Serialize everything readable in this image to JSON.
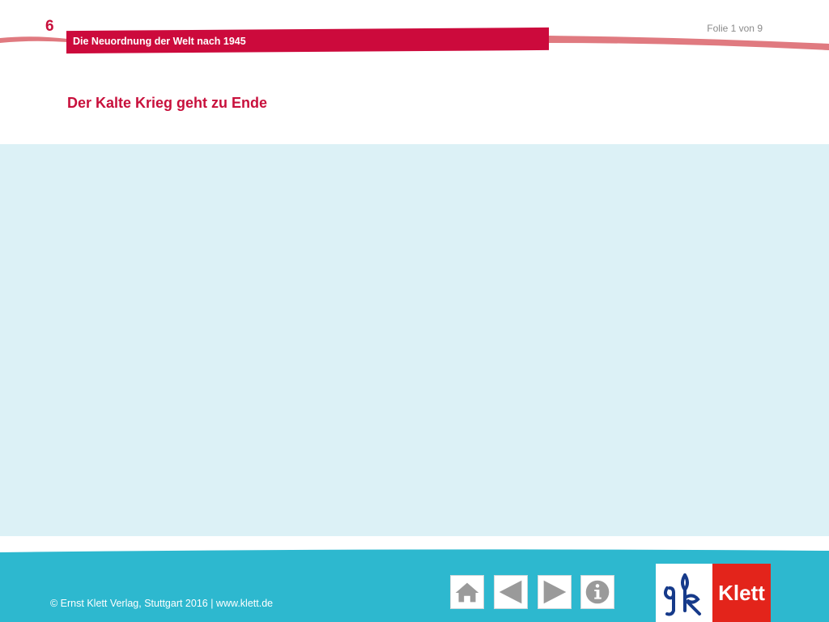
{
  "header": {
    "chapter_number": "6",
    "chapter_title": "Die Neuordnung der Welt nach 1945",
    "slide_counter": "Folie 1 von 9"
  },
  "slide": {
    "title": "Der Kalte Krieg geht zu Ende"
  },
  "footer": {
    "copyright": "© Ernst Klett Verlag, Stuttgart 2016 | www.klett.de",
    "nav": [
      {
        "name": "home",
        "icon": "home-icon"
      },
      {
        "name": "previous",
        "icon": "arrow-left-icon"
      },
      {
        "name": "next",
        "icon": "arrow-right-icon"
      },
      {
        "name": "info",
        "icon": "info-icon"
      }
    ],
    "logo_text": "Klett"
  },
  "colors": {
    "accent_red": "#cc0a3c",
    "content_background": "#dcf1f6",
    "footer_teal": "#2db8cf",
    "icon_gray": "#9a9a9a",
    "klett_red": "#e3241b",
    "klett_blue": "#163a8a"
  }
}
